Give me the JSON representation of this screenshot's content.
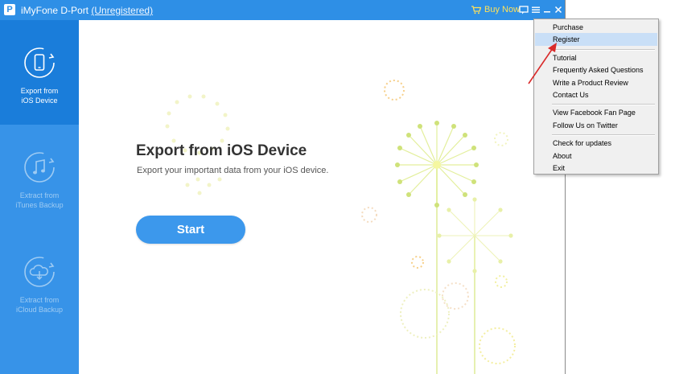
{
  "titlebar": {
    "app_name": "iMyFone D-Port",
    "status": "(Unregistered)",
    "buy_now": "Buy Now"
  },
  "sidebar": {
    "items": [
      {
        "label": "Export from\niOS Device",
        "icon": "phone-export-icon",
        "active": true
      },
      {
        "label": "Extract from\niTunes Backup",
        "icon": "music-note-icon",
        "active": false
      },
      {
        "label": "Extract from\niCloud Backup",
        "icon": "cloud-download-icon",
        "active": false
      }
    ]
  },
  "main": {
    "title": "Export from iOS Device",
    "subtitle": "Export your important data from your iOS device.",
    "start_label": "Start"
  },
  "menu": {
    "purchase": "Purchase",
    "register": "Register",
    "tutorial": "Tutorial",
    "faq": "Frequently Asked Questions",
    "review": "Write a Product Review",
    "contact": "Contact Us",
    "facebook": "View Facebook Fan Page",
    "twitter": "Follow Us on Twitter",
    "updates": "Check for updates",
    "about": "About",
    "exit": "Exit"
  },
  "colors": {
    "accent": "#2e8fe6",
    "sidebar_active": "#1a7dda",
    "buy_now": "#ffe15a",
    "menu_highlight": "#c9dff7",
    "arrow": "#d92b2b"
  }
}
